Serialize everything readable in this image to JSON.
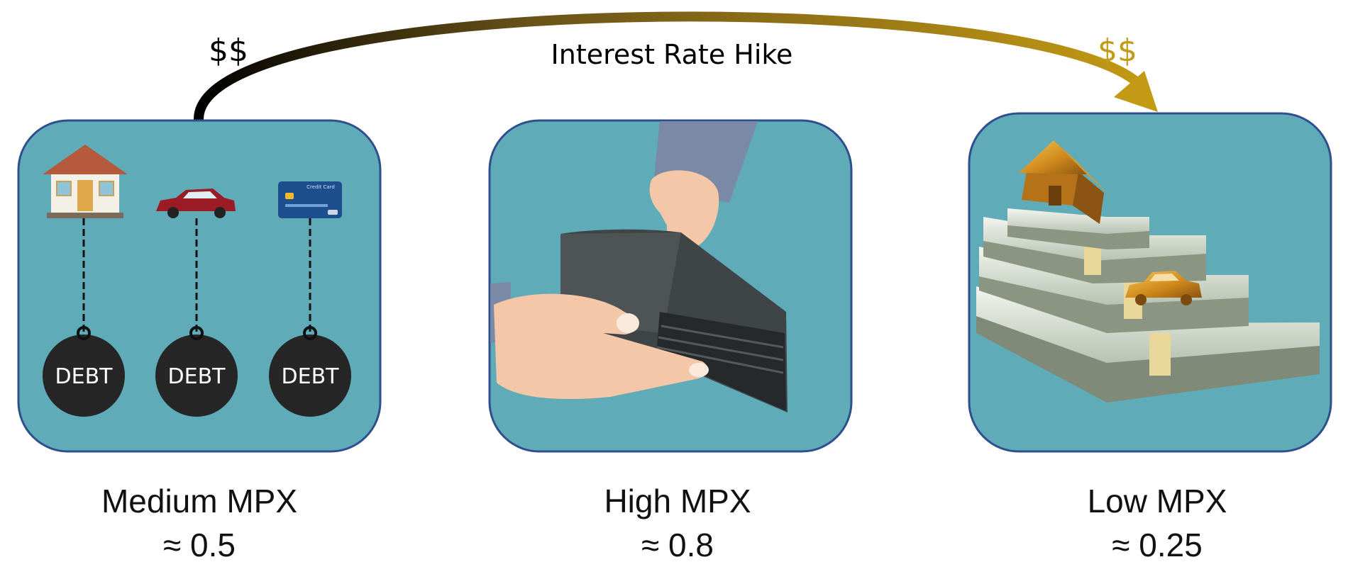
{
  "arrow": {
    "label": "Interest Rate Hike",
    "start_label": "$$",
    "end_label": "$$",
    "start_color": "#000000",
    "end_color": "#C39A14"
  },
  "panels": [
    {
      "title": "Medium MPX",
      "value": "≈ 0.5",
      "icons": [
        "house-icon",
        "car-icon",
        "credit-card-icon"
      ],
      "ball_label": "DEBT"
    },
    {
      "title": "High MPX",
      "value": "≈ 0.8",
      "icons": [
        "empty-wallet-icon",
        "hand-icon"
      ]
    },
    {
      "title": "Low MPX",
      "value": "≈ 0.25",
      "icons": [
        "gold-house-icon",
        "money-stack-icon",
        "gold-car-icon"
      ]
    }
  ],
  "colors": {
    "panel_fill": "#5FABB8",
    "panel_border": "#2F4F8F",
    "ball": "#262626",
    "gold": "#C39A14"
  }
}
